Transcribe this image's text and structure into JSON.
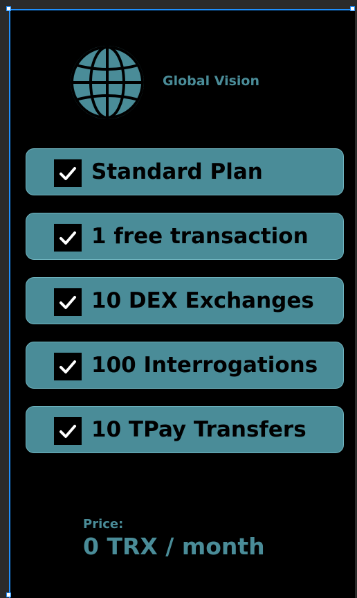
{
  "brand": {
    "name": "Global Vision",
    "logo_icon": "globe-icon",
    "accent_color": "#4a8c98"
  },
  "plan": {
    "features": [
      {
        "label": "Standard Plan",
        "checked": true
      },
      {
        "label": "1 free transaction",
        "checked": true
      },
      {
        "label": "10 DEX Exchanges",
        "checked": true
      },
      {
        "label": "100 Interrogations",
        "checked": true
      },
      {
        "label": "10 TPay Transfers",
        "checked": true
      }
    ],
    "check_icon": "checkbox-checked-icon"
  },
  "pricing": {
    "label": "Price:",
    "value": "0 TRX / month"
  }
}
